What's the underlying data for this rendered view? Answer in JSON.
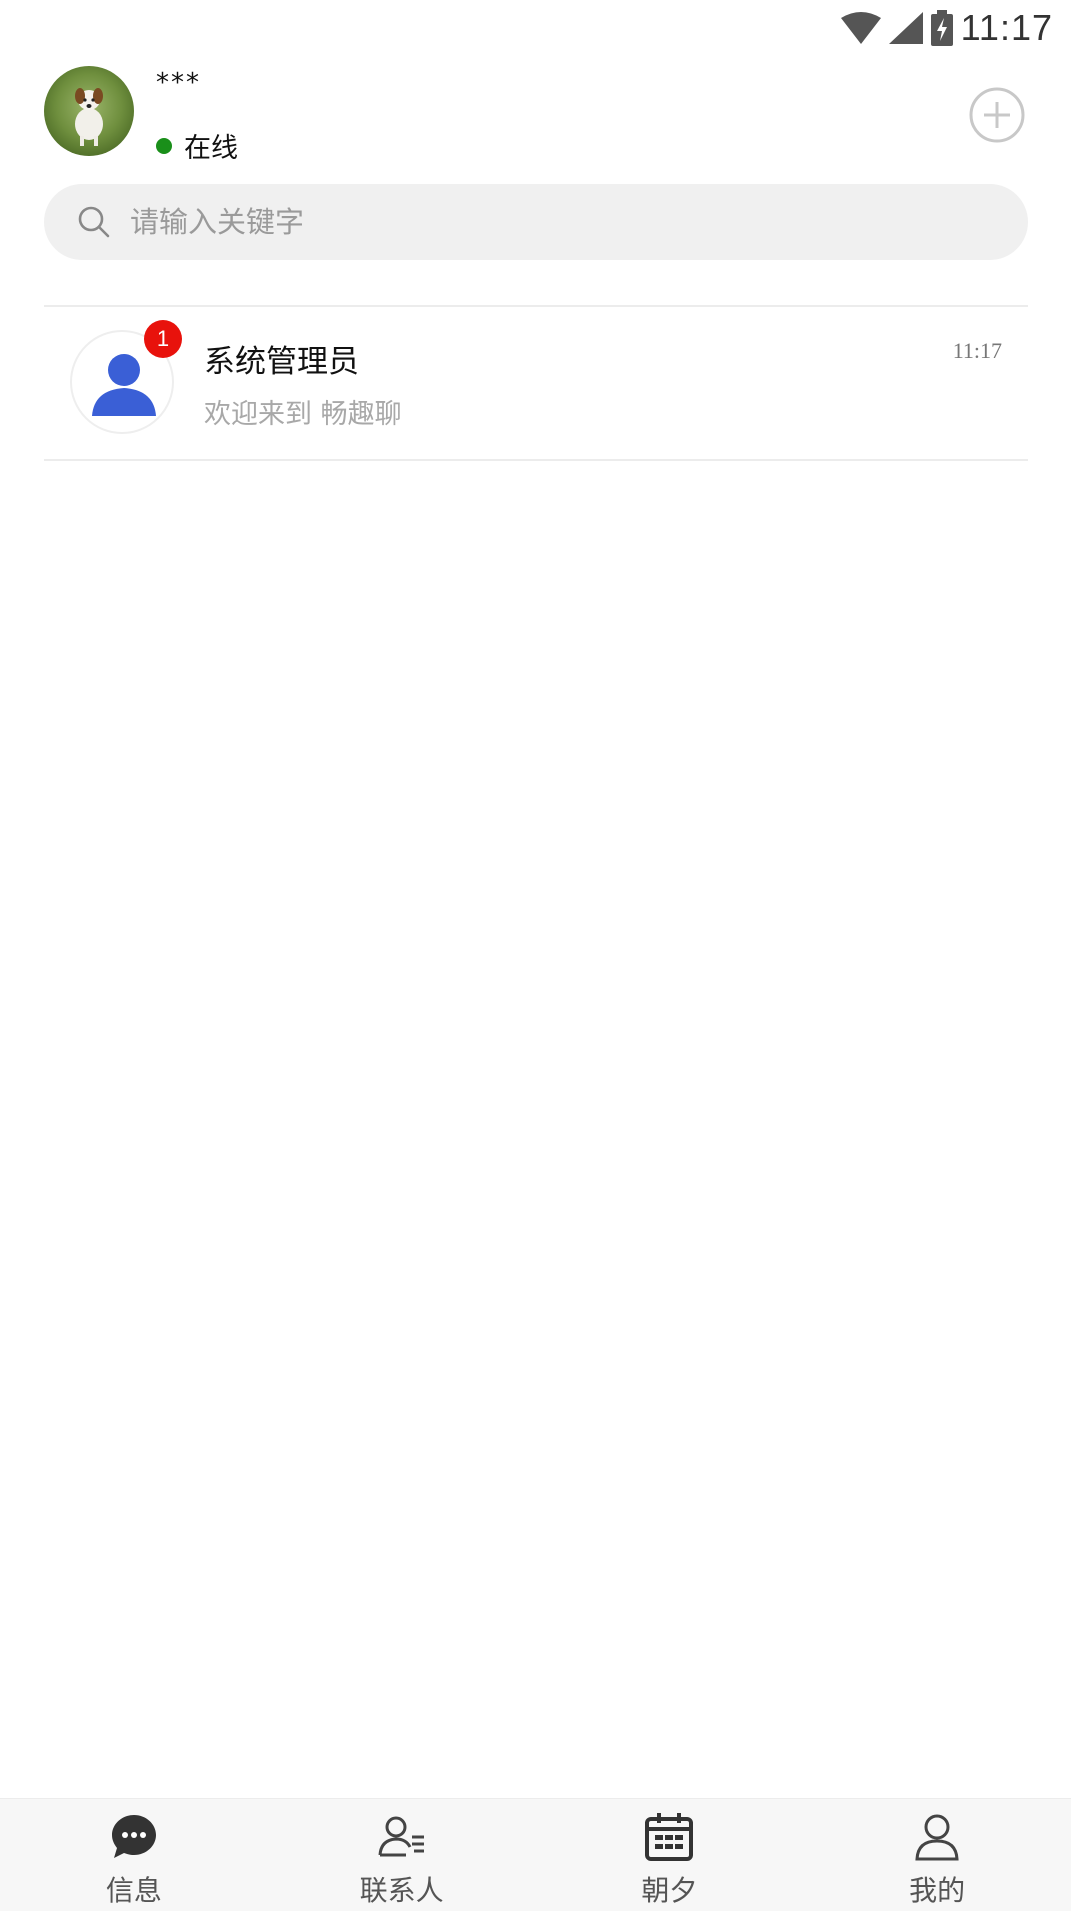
{
  "status_bar": {
    "time": "11:17",
    "icons": [
      "wifi-icon",
      "cell-signal-icon",
      "battery-charging-icon"
    ]
  },
  "header": {
    "username": "***",
    "status_label": "在线",
    "status_color": "#1a8f1a",
    "add_icon": "plus-circle-icon"
  },
  "search": {
    "placeholder": "请输入关键字",
    "value": ""
  },
  "conversations": [
    {
      "name": "系统管理员",
      "time": "11:17",
      "preview": "欢迎来到 畅趣聊",
      "unread": "1",
      "avatar_icon": "person-icon",
      "avatar_color": "#3a5fd6"
    }
  ],
  "tabs": [
    {
      "label": "信息",
      "icon": "chat-bubble-icon",
      "active": true
    },
    {
      "label": "联系人",
      "icon": "contacts-icon",
      "active": false
    },
    {
      "label": "朝夕",
      "icon": "calendar-icon",
      "active": false
    },
    {
      "label": "我的",
      "icon": "profile-icon",
      "active": false
    }
  ],
  "colors": {
    "badge": "#e8120c",
    "accent_blue": "#3a5fd6",
    "tab_bar_bg": "#f7f7f7"
  }
}
